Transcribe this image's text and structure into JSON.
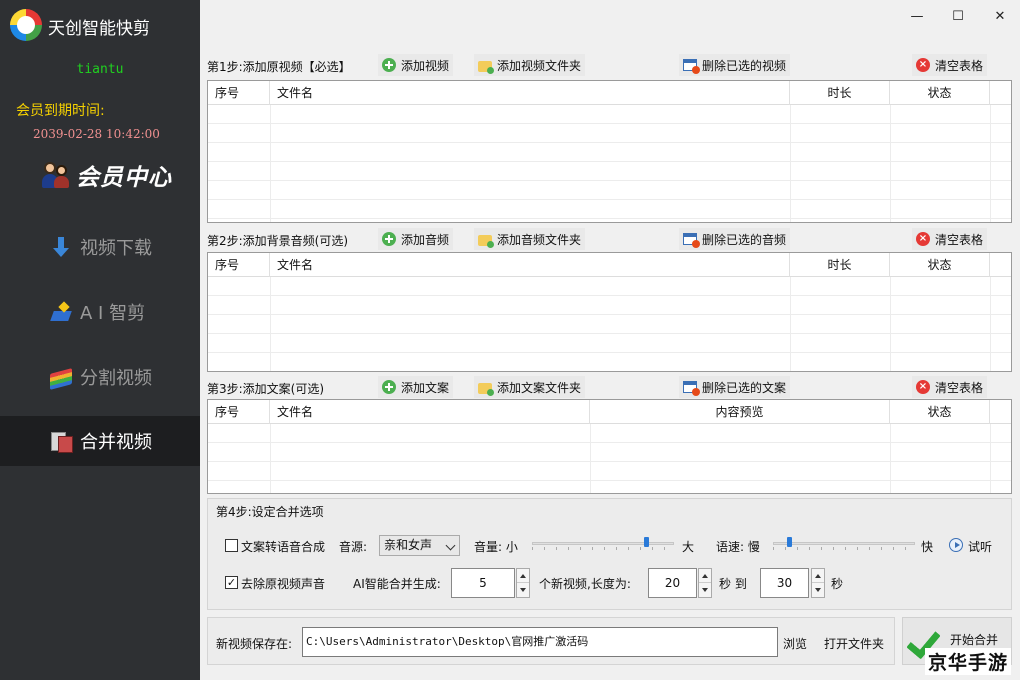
{
  "app": {
    "title": "天创智能快剪"
  },
  "sidebar": {
    "username": "tiantu",
    "expiry_label": "会员到期时间:",
    "expiry_value": "2039-02-28 10:42:00",
    "member_center": "会员中心",
    "nav": [
      {
        "label": "视频下载",
        "icon": "download-arrow-icon"
      },
      {
        "label": "A I 智剪",
        "icon": "ai-edit-icon"
      },
      {
        "label": "分割视频",
        "icon": "split-video-icon"
      },
      {
        "label": "合并视频",
        "icon": "merge-video-icon",
        "active": true
      }
    ]
  },
  "window": {
    "minimize": "—",
    "maximize": "☐",
    "close": "✕"
  },
  "step1": {
    "label": "第1步:添加原视频【必选】",
    "add": "添加视频",
    "add_folder": "添加视频文件夹",
    "delete": "删除已选的视频",
    "clear": "清空表格",
    "columns": [
      "序号",
      "文件名",
      "时长",
      "状态"
    ]
  },
  "step2": {
    "label": "第2步:添加背景音频(可选)",
    "add": "添加音频",
    "add_folder": "添加音频文件夹",
    "delete": "删除已选的音频",
    "clear": "清空表格",
    "columns": [
      "序号",
      "文件名",
      "时长",
      "状态"
    ]
  },
  "step3": {
    "label": "第3步:添加文案(可选)",
    "add": "添加文案",
    "add_folder": "添加文案文件夹",
    "delete": "删除已选的文案",
    "clear": "清空表格",
    "columns": [
      "序号",
      "文件名",
      "内容预览",
      "状态"
    ]
  },
  "step4": {
    "label": "第4步:设定合并选项",
    "tts_label": "文案转语音合成",
    "tts_checked": false,
    "voice_label": "音源:",
    "voice_value": "亲和女声",
    "volume_label": "音量: 小",
    "volume_max": "大",
    "volume_level": 0.82,
    "speed_label": "语速: 慢",
    "speed_max": "快",
    "speed_level": 0.1,
    "preview": "试听",
    "mute_label": "去除原视频声音",
    "mute_checked": true,
    "ai_label": "AI智能合并生成:",
    "count": "5",
    "count_suffix": "个新视频,长度为:",
    "min_len": "20",
    "to": "秒 到",
    "max_len": "30",
    "sec": "秒"
  },
  "save": {
    "label": "新视频保存在:",
    "path": "C:\\Users\\Administrator\\Desktop\\官网推广激活码",
    "browse": "浏览",
    "open_folder": "打开文件夹",
    "start": "开始合并"
  },
  "watermark": "京华手游"
}
